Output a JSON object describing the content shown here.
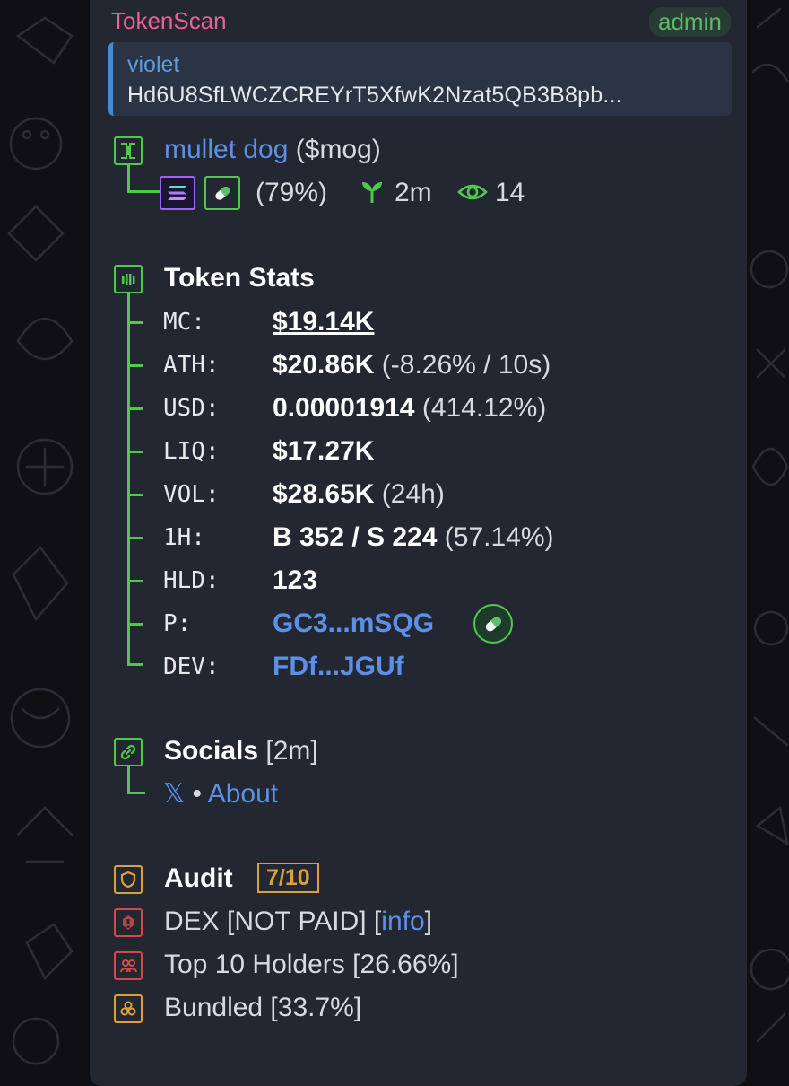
{
  "message": {
    "sender": "TokenScan",
    "badge": "admin",
    "reply": {
      "name": "violet",
      "text": "Hd6U8SfLWCZCREYrT5XfwK2Nzat5QB3B8pb..."
    },
    "token": {
      "name": "mullet dog",
      "symbol": "($mog)",
      "percent": "(79%)",
      "age": "2m",
      "views": "14"
    },
    "stats": {
      "title": "Token Stats",
      "rows": [
        {
          "label": "MC:",
          "value": "$19.14K",
          "extra": ""
        },
        {
          "label": "ATH:",
          "value": "$20.86K",
          "extra": " (-8.26% / 10s)"
        },
        {
          "label": "USD:",
          "value": "0.00001914",
          "extra": " (414.12%)"
        },
        {
          "label": "LIQ:",
          "value": "$17.27K",
          "extra": ""
        },
        {
          "label": "VOL:",
          "value": "$28.65K",
          "extra": " (24h)"
        },
        {
          "label": "1H:",
          "value": "B 352 / S 224",
          "extra": " (57.14%)"
        },
        {
          "label": "HLD:",
          "value": "123",
          "extra": ""
        },
        {
          "label": "P:",
          "value": "GC3...mSQG",
          "extra": ""
        },
        {
          "label": "DEV:",
          "value": "FDf...JGUf",
          "extra": ""
        }
      ]
    },
    "socials": {
      "title": "Socials",
      "age": "[2m]",
      "x_label": "𝕏",
      "separator": "•",
      "about_label": "About"
    },
    "audit": {
      "title": "Audit",
      "score": "7/10",
      "dex_text": "DEX [NOT PAID] [",
      "dex_link": "info",
      "dex_close": "]",
      "holders_text": "Top 10 Holders [26.66%]",
      "bundled_text": "Bundled [33.7%]"
    }
  },
  "colors": {
    "bubble": "#222731",
    "accent_green": "#4fc84c",
    "audit_yellow": "#d9a13a",
    "audit_red": "#d24a4a",
    "link_blue": "#5c8fe6",
    "sender_pink": "#e9609a"
  }
}
